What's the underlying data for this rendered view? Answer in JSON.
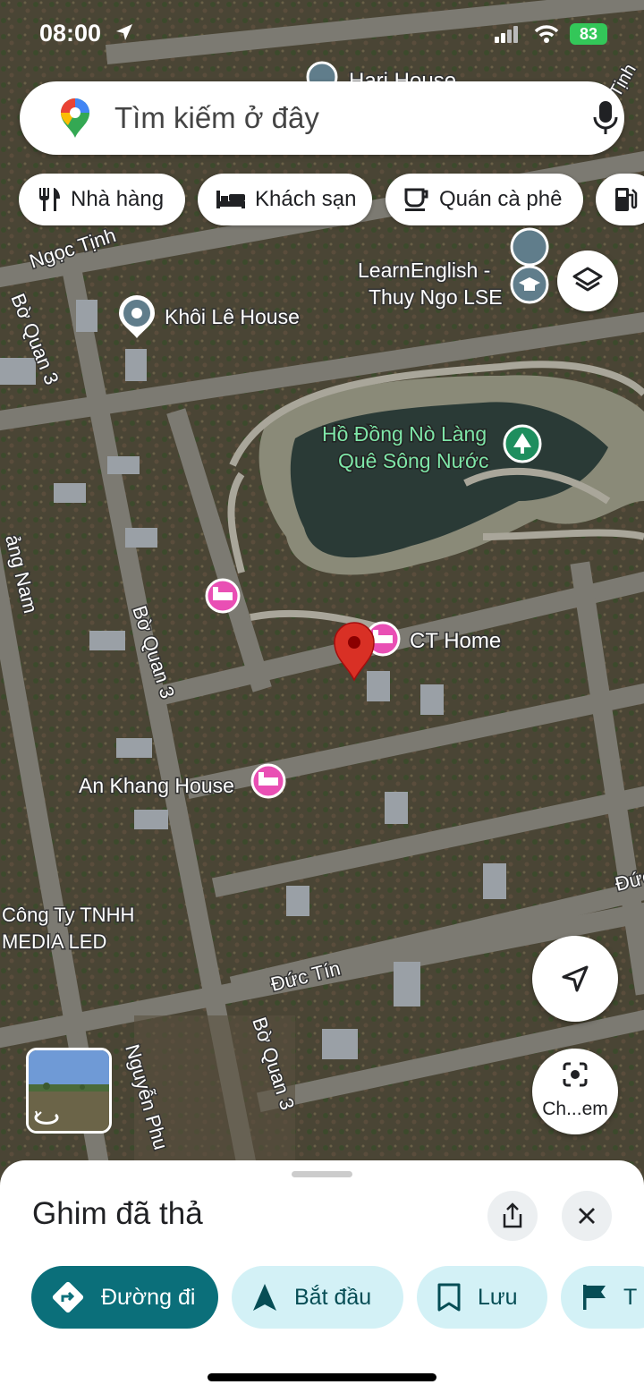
{
  "status_bar": {
    "time": "08:00",
    "battery": "83"
  },
  "search": {
    "placeholder": "Tìm kiếm ở đây"
  },
  "chips": [
    {
      "label": "Nhà hàng",
      "icon": "restaurant-icon"
    },
    {
      "label": "Khách sạn",
      "icon": "hotel-icon"
    },
    {
      "label": "Quán cà phê",
      "icon": "coffee-icon"
    },
    {
      "label": "",
      "icon": "gas-station-icon"
    }
  ],
  "map": {
    "roads": {
      "ngoc_tinh": "Ngọc Tịnh",
      "bo_quan_3_top": "Bờ Quan 3",
      "bo_quan_3_mid": "Bờ Quan 3",
      "bo_quan_3_bottom": "Bờ Quan 3",
      "quang_nam": "ảng Nam",
      "duc_tin": "Đức Tín",
      "duc_right": "Đức",
      "nguyen_phu": "Nguyễn Phu",
      "tinh_right": "Tịnh"
    },
    "places": {
      "hari_house": "Hari House",
      "learn_english_line1": "LearnEnglish -",
      "learn_english_line2": "Thuy Ngo LSE",
      "khoi_le_house": "Khôi Lê House",
      "lake_line1": "Hồ Đồng Nò Làng",
      "lake_line2": "Quê Sông Nước",
      "ct_home": "CT Home",
      "an_khang_house": "An Khang House",
      "cong_ty_line1": "Công Ty TNHH",
      "cong_ty_line2": "MEDIA LED"
    },
    "colors": {
      "hotel_pin": "#e94fb4",
      "dropped_pin": "#d93025",
      "park_pin": "#1e8e5e",
      "poi_pin": "#607d8b"
    }
  },
  "camera_button": {
    "label": "Ch...em"
  },
  "sheet": {
    "title": "Ghim đã thả",
    "actions": [
      {
        "label": "Đường đi",
        "icon": "directions-icon"
      },
      {
        "label": "Bắt đầu",
        "icon": "navigation-arrow-icon"
      },
      {
        "label": "Lưu",
        "icon": "bookmark-icon"
      },
      {
        "label": "T",
        "icon": "flag-icon"
      }
    ]
  }
}
